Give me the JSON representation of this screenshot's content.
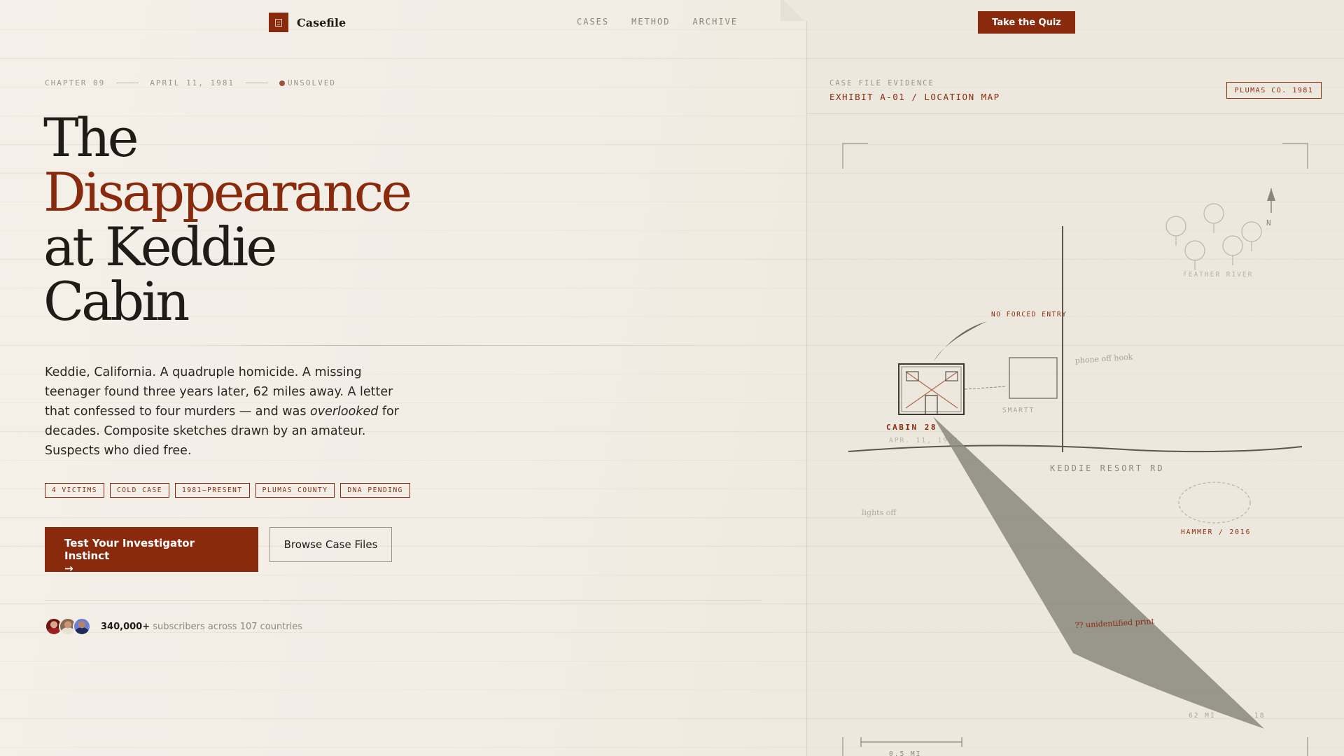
{
  "brand": {
    "name": "Casefile"
  },
  "nav": {
    "items": [
      "CASES",
      "METHOD",
      "ARCHIVE"
    ],
    "quiz_label": "Take the Quiz"
  },
  "meta": {
    "chapter": "CHAPTER 09",
    "date": "APRIL 11, 1981",
    "status": "UNSOLVED"
  },
  "headline": {
    "line1": "The",
    "line2": "Disappearance",
    "line3": "at Keddie",
    "line4": "Cabin"
  },
  "lede": {
    "part1": "Keddie, California. A quadruple homicide. A missing teenager found three years later, 62 miles away. A letter that confessed to four murders — and was ",
    "emphasis": "overlooked",
    "part2": " for decades. Composite sketches drawn by an amateur. Suspects who died free."
  },
  "tags": [
    "4 VICTIMS",
    "COLD CASE",
    "1981–PRESENT",
    "PLUMAS COUNTY",
    "DNA PENDING"
  ],
  "cta": {
    "primary": "Test Your Investigator Instinct",
    "primary_arrow": "→",
    "secondary": "Browse Case Files"
  },
  "social": {
    "count": "340,000+",
    "text": "subscribers across 107 countries"
  },
  "evidence": {
    "label": "CASE FILE EVIDENCE",
    "title": "EXHIBIT A-01 / LOCATION MAP",
    "stamp": "PLUMAS CO. 1981"
  },
  "map": {
    "north": "N",
    "river": "FEATHER RIVER",
    "no_forced_entry": "NO FORCED ENTRY",
    "phone": "phone off hook",
    "cabin": "CABIN 28",
    "cabin_date": "APR. 11, 1981",
    "neighbor": "SMARTT",
    "road": "KEDDIE RESORT RD",
    "lights": "lights off",
    "hammer": "HAMMER / 2016",
    "print": "?? unidentified print",
    "distance": "62 MI",
    "distance_suffix": "18",
    "scale": "0.5 MI"
  },
  "colors": {
    "accent": "#8a2a0c",
    "paper": "#f2eee6",
    "ink": "#1f1b17"
  }
}
